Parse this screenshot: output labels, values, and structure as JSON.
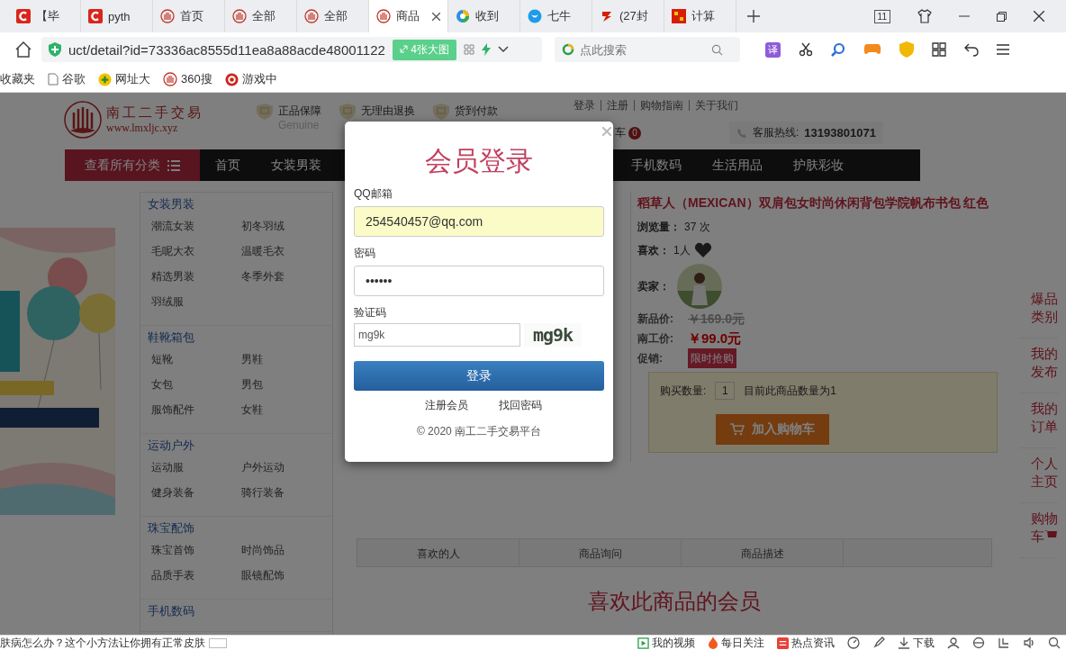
{
  "browser": {
    "tabs": [
      {
        "label": "【毕",
        "selected": false
      },
      {
        "label": "pyth",
        "selected": false
      },
      {
        "label": "首页",
        "selected": false
      },
      {
        "label": "全部",
        "selected": false
      },
      {
        "label": "全部",
        "selected": false
      },
      {
        "label": "商品",
        "selected": true
      },
      {
        "label": "收到",
        "selected": false
      },
      {
        "label": "七牛",
        "selected": false
      },
      {
        "label": "(27封",
        "selected": false
      },
      {
        "label": "计算",
        "selected": false
      }
    ],
    "tab_count": "11",
    "url": "uct/detail?id=73336ac8555d11ea8a88acde48001122",
    "image_button": "4张大图",
    "search": {
      "placeholder": "点此搜索"
    },
    "translate": "译",
    "bookmarks": [
      "收藏夹",
      "谷歌",
      "网址大",
      "360搜",
      "游戏中"
    ]
  },
  "site": {
    "logo": {
      "name": "南工二手交易",
      "url": "www.lmxljc.xyz"
    },
    "features": [
      {
        "title": "正品保障",
        "subtitle": "Genuine"
      },
      {
        "title": "无理由退换"
      },
      {
        "title": "货到付款"
      }
    ],
    "top_links": [
      "登录",
      "注册",
      "购物指南",
      "关于我们"
    ],
    "cart": {
      "label": "车",
      "count": "0"
    },
    "hotline": {
      "label": "客服热线:",
      "number": "13193801071"
    },
    "category_button": "查看所有分类",
    "nav": [
      "首页",
      "女装男装",
      "手机数码",
      "生活用品",
      "护肤彩妆"
    ]
  },
  "banner": {
    "kind": "picture"
  },
  "categories": [
    {
      "title": "女装男装",
      "items": [
        "潮流女装",
        "初冬羽绒",
        "毛呢大衣",
        "温暖毛衣",
        "精选男装",
        "冬季外套",
        "羽绒服"
      ]
    },
    {
      "title": "鞋靴箱包",
      "items": [
        "短靴",
        "男鞋",
        "女包",
        "男包",
        "服饰配件",
        "女鞋"
      ]
    },
    {
      "title": "运动户外",
      "items": [
        "运动服",
        "户外运动",
        "健身装备",
        "骑行装备"
      ]
    },
    {
      "title": "珠宝配饰",
      "items": [
        "珠宝首饰",
        "时尚饰品",
        "品质手表",
        "眼镜配饰"
      ]
    },
    {
      "title": "手机数码"
    }
  ],
  "product": {
    "title": "稻草人（MEXICAN）双肩包女时尚休闲背包学院帆布书包 红色",
    "views_label": "浏览量：",
    "views": "37 次",
    "likes_label": "喜欢：",
    "likes": "1人",
    "seller_label": "卖家：",
    "new_price_label": "新品价:",
    "new_price": "￥169.0元",
    "price_label": "南工价:",
    "price": "￥99.0元",
    "promo_label": "促销:",
    "promo": "限时抢购",
    "quantity_label": "购买数量:",
    "quantity": "1",
    "stock": "目前此商品数量为1",
    "add_to_cart": "加入购物车"
  },
  "side_menu": [
    {
      "label": "爆品类别",
      "cart": false
    },
    {
      "label": "我的发布",
      "cart": false
    },
    {
      "label": "我的订单",
      "cart": false
    },
    {
      "label": "个人主页",
      "cart": false
    },
    {
      "label": "购物车",
      "cart": true
    }
  ],
  "detail_tabs": [
    "喜欢的人",
    "商品询问",
    "商品描述"
  ],
  "likers_heading": "喜欢此商品的会员",
  "login": {
    "title": "会员登录",
    "email_label": "QQ邮箱",
    "email": "254540457@qq.com",
    "password_label": "密码",
    "password": "••••••",
    "captcha_label": "验证码",
    "captcha_input": "mg9k",
    "captcha_image": "mg9k",
    "submit": "登录",
    "links": [
      "注册会员",
      "找回密码"
    ],
    "footer": "© 2020 南工二手交易平台"
  },
  "status_bar": {
    "news": "肤病怎么办？这个小方法让你拥有正常皮肤",
    "items": [
      {
        "kind": "labeled",
        "label": "我的视频"
      },
      {
        "kind": "labeled",
        "label": "每日关注"
      },
      {
        "kind": "labeled",
        "label": "热点资讯"
      },
      {
        "kind": "icon"
      },
      {
        "kind": "icon"
      },
      {
        "kind": "labeled",
        "label": "下载"
      },
      {
        "kind": "icon"
      },
      {
        "kind": "icon"
      },
      {
        "kind": "icon"
      },
      {
        "kind": "icon"
      },
      {
        "kind": "icon"
      }
    ]
  }
}
